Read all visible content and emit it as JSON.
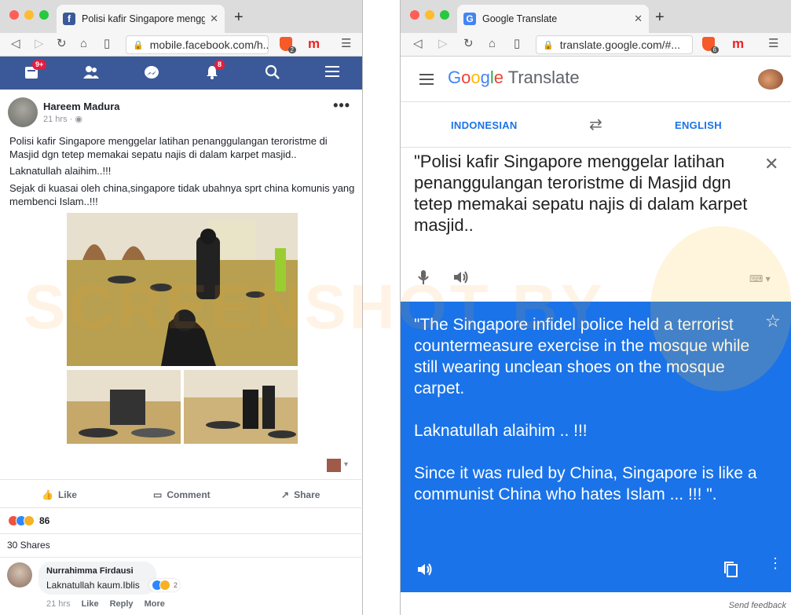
{
  "left_window": {
    "tab_title": "Polisi kafir Singapore menggelar la",
    "tab_favicon_letter": "f",
    "url": "mobile.facebook.com/h...",
    "brave_badge": "2"
  },
  "facebook": {
    "nav": {
      "home_badge": "9+",
      "notif_badge": "8"
    },
    "post": {
      "author": "Hareem Madura",
      "time": "21 hrs · ",
      "paragraphs": [
        "Polisi kafir Singapore menggelar latihan penanggulangan teroristme di Masjid dgn tetep memakai sepatu najis di dalam karpet masjid..",
        "Laknatullah alaihim..!!!",
        "Sejak di kuasai oleh china,singapore tidak ubahnya sprt china komunis yang membenci Islam..!!!"
      ],
      "actions": {
        "like": "Like",
        "comment": "Comment",
        "share": "Share"
      },
      "reaction_count": "86",
      "shares": "30 Shares"
    },
    "comment": {
      "author": "Nurrahimma Firdausi",
      "text": "Laknatullah kaum.Iblis",
      "reaction_count": "2",
      "time": "21 hrs",
      "like": "Like",
      "reply": "Reply",
      "more": "More"
    }
  },
  "right_window": {
    "tab_title": "Google Translate",
    "url": "translate.google.com/#...",
    "brave_badge": "6"
  },
  "translate": {
    "logo_google": "Google",
    "logo_translate": "Translate",
    "source_lang": "INDONESIAN",
    "target_lang": "ENGLISH",
    "source_text": "\"Polisi kafir Singapore menggelar latihan penanggulangan teroristme di Masjid dgn tetep memakai sepatu najis di dalam karpet masjid..",
    "output_text": "\"The Singapore infidel police held a terrorist countermeasure exercise in the mosque while still wearing unclean shoes on the mosque carpet.\n\nLaknatullah alaihim .. !!!\n\nSince it was ruled by China, Singapore is like a communist China who hates Islam ... !!! \".",
    "send_feedback": "Send feedback"
  },
  "watermark": "SCREENSHOT BY",
  "colors": {
    "facebook_blue": "#3b5998",
    "translate_blue": "#1a73e8",
    "badge_red": "#e41e3f"
  }
}
